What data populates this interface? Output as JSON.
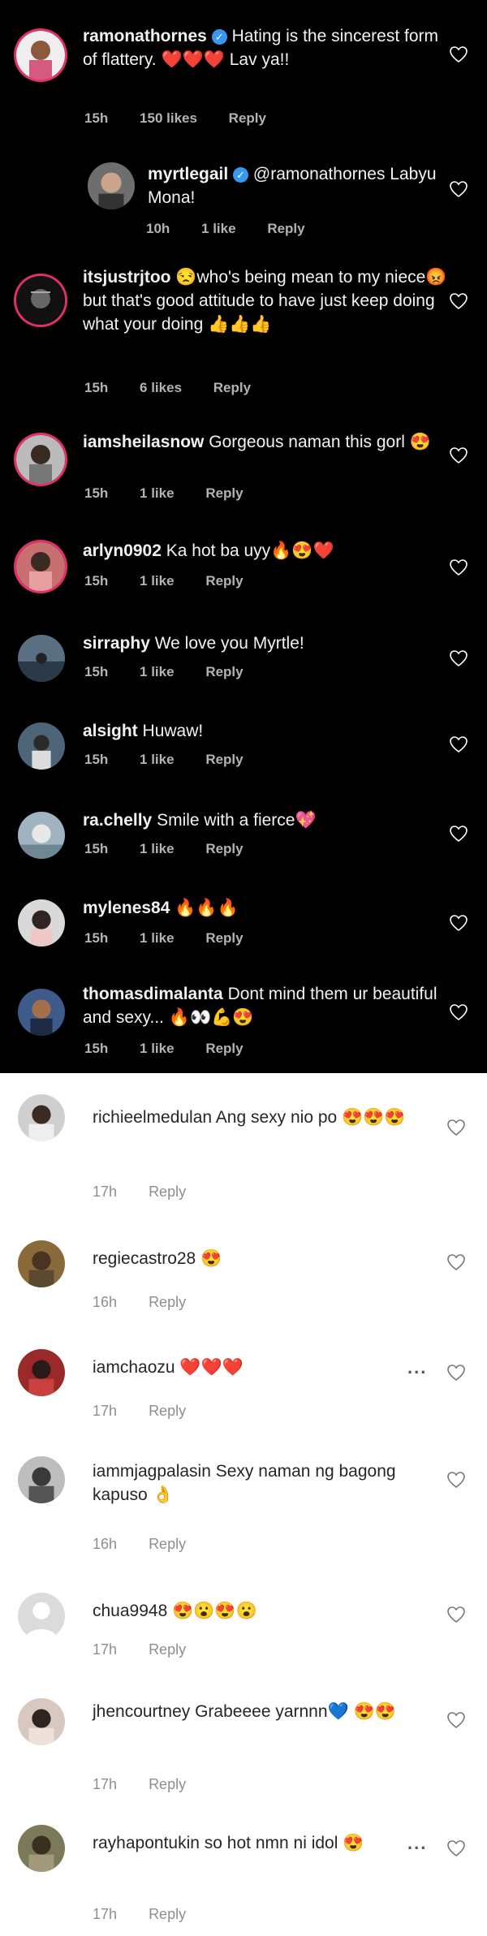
{
  "dark_comments": [
    {
      "user": "ramonathornes",
      "verified": true,
      "text": "Hating is the sincerest form of flattery. ❤️❤️❤️ Lav ya!!",
      "time": "15h",
      "likes": "150 likes",
      "reply": "Reply"
    },
    {
      "user": "myrtlegail",
      "verified": true,
      "text": "@ramonathornes Labyu Mona!",
      "time": "10h",
      "likes": "1 like",
      "reply": "Reply"
    },
    {
      "user": "itsjustrjtoo",
      "verified": false,
      "text": "😒who's being mean to my niece😡 but that's good attitude to have just keep doing what your doing 👍👍👍",
      "time": "15h",
      "likes": "6 likes",
      "reply": "Reply"
    },
    {
      "user": "iamsheilasnow",
      "verified": false,
      "text": "Gorgeous naman this gorl 😍",
      "time": "15h",
      "likes": "1 like",
      "reply": "Reply"
    },
    {
      "user": "arlyn0902",
      "verified": false,
      "text": "Ka hot ba uyy🔥😍❤️",
      "time": "15h",
      "likes": "1 like",
      "reply": "Reply"
    },
    {
      "user": "sirraphy",
      "verified": false,
      "text": "We love you Myrtle!",
      "time": "15h",
      "likes": "1 like",
      "reply": "Reply"
    },
    {
      "user": "alsight",
      "verified": false,
      "text": "Huwaw!",
      "time": "15h",
      "likes": "1 like",
      "reply": "Reply"
    },
    {
      "user": "ra.chelly",
      "verified": false,
      "text": "Smile with a fierce💖",
      "time": "15h",
      "likes": "1 like",
      "reply": "Reply"
    },
    {
      "user": "mylenes84",
      "verified": false,
      "text": "🔥🔥🔥",
      "time": "15h",
      "likes": "1 like",
      "reply": "Reply"
    },
    {
      "user": "thomasdimalanta",
      "verified": false,
      "text": "Dont mind them ur beautiful and sexy... 🔥👀💪😍",
      "time": "15h",
      "likes": "1 like",
      "reply": "Reply"
    }
  ],
  "light_comments": [
    {
      "user": "richieelmedulan",
      "text": "Ang sexy nio po 😍😍😍",
      "time": "17h",
      "reply": "Reply"
    },
    {
      "user": "regiecastro28",
      "text": "😍",
      "time": "16h",
      "reply": "Reply"
    },
    {
      "user": "iamchaozu",
      "text": "❤️❤️❤️",
      "time": "17h",
      "reply": "Reply",
      "more": "..."
    },
    {
      "user": "iammjagpalasin",
      "text": "Sexy naman ng bagong kapuso 👌",
      "time": "16h",
      "reply": "Reply"
    },
    {
      "user": "chua9948",
      "text": "😍😮😍😮",
      "time": "17h",
      "reply": "Reply"
    },
    {
      "user": "jhencourtney",
      "text": "Grabeeee yarnnn💙 😍😍",
      "time": "17h",
      "reply": "Reply"
    },
    {
      "user": "rayhapontukin",
      "text": "so hot nmn ni idol 😍",
      "time": "17h",
      "reply": "Reply",
      "more": "..."
    }
  ],
  "colors": {
    "dark_bg": "#000000",
    "light_bg": "#ffffff",
    "verified": "#3897f0",
    "ring": "#e1306c"
  }
}
